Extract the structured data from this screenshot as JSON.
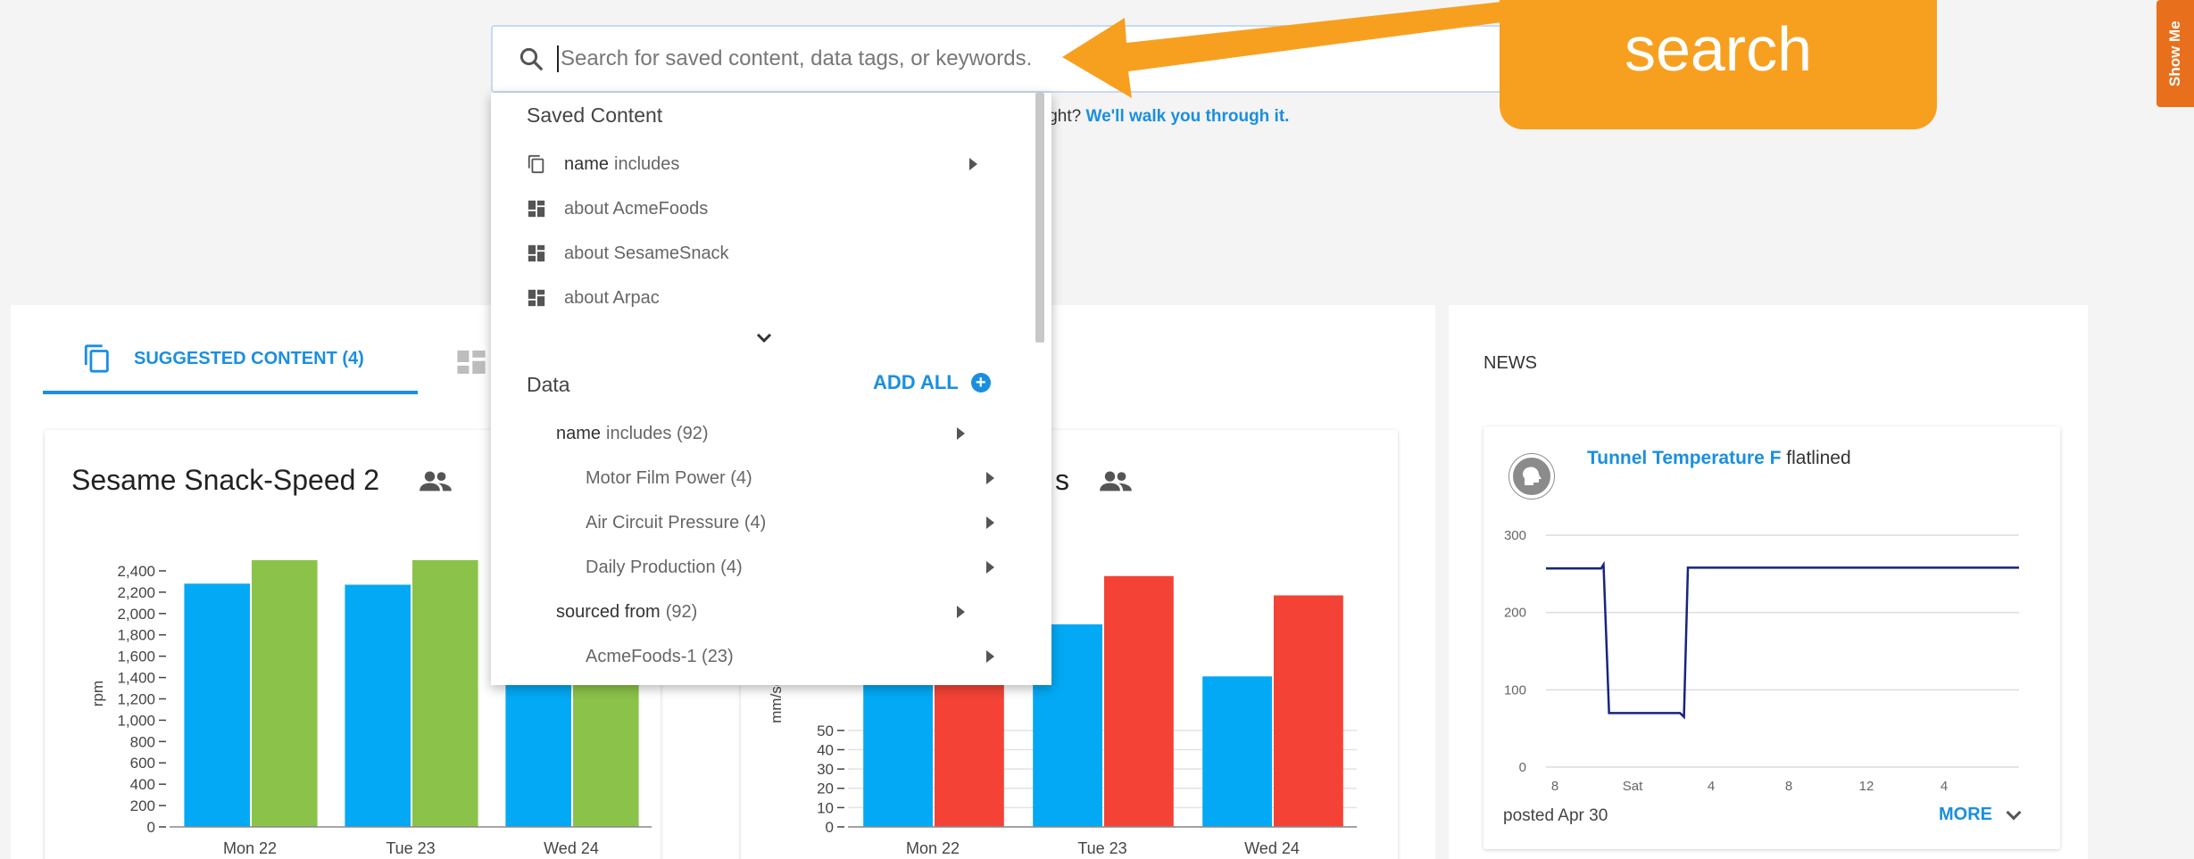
{
  "search": {
    "placeholder": "Search for saved content, data tags, or keywords.",
    "help_prefix": "ight?",
    "help_link": "We'll walk you through it."
  },
  "callout": {
    "text": "search"
  },
  "show_me": {
    "label": "Show Me"
  },
  "tabs": [
    {
      "label": "SUGGESTED CONTENT (4)",
      "icon": "content-copy-icon",
      "active": true
    },
    {
      "label": "",
      "icon": "dashboard-icon",
      "active": false
    }
  ],
  "dropdown": {
    "saved_content": {
      "heading": "Saved Content",
      "items": [
        {
          "bold": "name",
          "text": "includes",
          "icon": "copy-icon",
          "has_submenu": true
        },
        {
          "bold": "",
          "text": "about AcmeFoods",
          "icon": "dashboard-icon",
          "has_submenu": false
        },
        {
          "bold": "",
          "text": "about SesameSnack",
          "icon": "dashboard-icon",
          "has_submenu": false
        },
        {
          "bold": "",
          "text": "about Arpac",
          "icon": "dashboard-icon",
          "has_submenu": false
        }
      ]
    },
    "data": {
      "heading": "Data",
      "add_all": "ADD ALL",
      "groups": [
        {
          "bold": "name",
          "text": "includes (92)",
          "children": [
            "Motor Film Power (4)",
            "Air Circuit Pressure (4)",
            "Daily Production (4)"
          ]
        },
        {
          "bold": "sourced from",
          "text": "(92)",
          "children": [
            "AcmeFoods-1 (23)"
          ]
        }
      ]
    }
  },
  "cards": [
    {
      "title": "Sesame Snack-Speed 2",
      "icon": "group-icon"
    },
    {
      "title": "s",
      "icon": "group-icon"
    }
  ],
  "news": {
    "heading": "NEWS",
    "item": {
      "link": "Tunnel Temperature F",
      "text": "flatlined",
      "posted": "posted Apr 30",
      "more": "MORE"
    }
  },
  "chart_data": [
    {
      "type": "bar",
      "categories": [
        "Mon 22",
        "Tue 23",
        "Wed 24"
      ],
      "series": [
        {
          "name": "",
          "color": "#03a9f4",
          "values": [
            2280,
            2270,
            1900
          ]
        },
        {
          "name": "",
          "color": "#8bc34a",
          "values": [
            2500,
            2500,
            2300
          ]
        }
      ],
      "ylabel": "rpm",
      "yticks": [
        0,
        200,
        400,
        600,
        800,
        1000,
        1200,
        1400,
        1600,
        1800,
        2000,
        2200,
        2400
      ],
      "ylim": [
        0,
        2500
      ],
      "grid": false
    },
    {
      "type": "bar",
      "categories": [
        "Mon 22",
        "Tue 23",
        "Wed 24"
      ],
      "series": [
        {
          "name": "",
          "color": "#03a9f4",
          "values": [
            80,
            105,
            78
          ]
        },
        {
          "name": "",
          "color": "#f44336",
          "values": [
            85,
            130,
            120
          ]
        }
      ],
      "ylabel": "mm/sec",
      "yticks": [
        0,
        10,
        20,
        30,
        40,
        50
      ],
      "ylim": [
        0,
        135
      ],
      "grid": true
    },
    {
      "type": "line",
      "ylim": [
        0,
        300
      ],
      "yticks": [
        0,
        100,
        200,
        300
      ],
      "xticks": [
        "8",
        "Sat",
        "4",
        "8",
        "12",
        "4"
      ],
      "series": [
        {
          "name": "",
          "color": "#1a237e",
          "x": [
            0,
            7,
            7.3,
            8,
            17,
            17.5,
            18,
            60
          ],
          "y": [
            257,
            257,
            262,
            70,
            70,
            65,
            258,
            258
          ]
        }
      ],
      "xlim": [
        0,
        60
      ]
    }
  ]
}
